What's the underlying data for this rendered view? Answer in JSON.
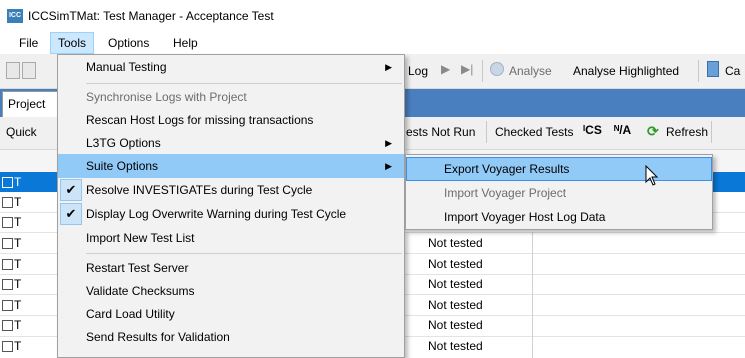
{
  "window": {
    "title": "ICCSimTMat: Test Manager - Acceptance Test",
    "icon": "ICC"
  },
  "menubar": {
    "items": [
      "File",
      "Tools",
      "Options",
      "Help"
    ]
  },
  "toolbar": {
    "log": "Log",
    "analyse": "Analyse",
    "analyse_highlighted": "Analyse Highlighted",
    "ca": "Ca"
  },
  "tabs": {
    "project": "Project"
  },
  "panel": {
    "quick": "Quick",
    "tests_not_run": "ests Not Run",
    "checked_tests": "Checked Tests",
    "ics_glyph": "ᴵCS",
    "na_glyph": "ᴺ/A",
    "refresh": "Refresh"
  },
  "grid": {
    "row_prefix": "T",
    "statuses": [
      "Not tested",
      "Not tested",
      "Not tested",
      "Not tested",
      "Not tested",
      "Not tested",
      "Not tested"
    ]
  },
  "tools_menu": {
    "manual_testing": "Manual Testing",
    "synchronise_logs": "Synchronise Logs with Project",
    "rescan_host_logs": "Rescan Host Logs for missing transactions",
    "l3tg_options": "L3TG Options",
    "suite_options": "Suite Options",
    "resolve_investigates": "Resolve INVESTIGATEs during Test Cycle",
    "display_log_overwrite": "Display Log Overwrite Warning during Test Cycle",
    "import_new_test_list": "Import New Test List",
    "restart_test_server": "Restart Test Server",
    "validate_checksums": "Validate Checksums",
    "card_load_utility": "Card Load Utility",
    "send_results": "Send Results for Validation"
  },
  "suite_submenu": {
    "export_voyager": "Export Voyager Results",
    "import_voyager_project": "Import Voyager Project",
    "import_voyager_host_log": "Import Voyager Host Log Data"
  },
  "colors": {
    "accent": "#0a78d7",
    "menu_hover": "#91c9f7",
    "tab_strip": "#4a7fbf"
  }
}
